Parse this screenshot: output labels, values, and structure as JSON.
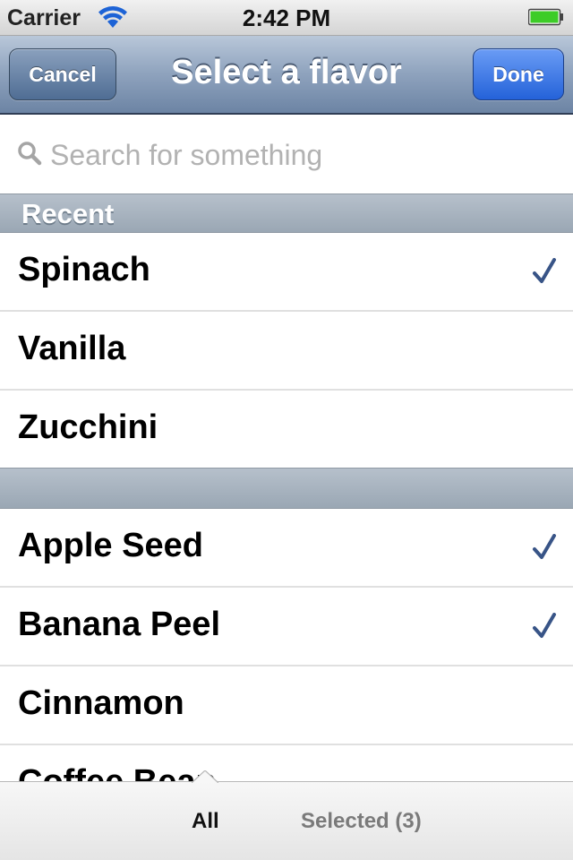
{
  "status_bar": {
    "carrier": "Carrier",
    "time": "2:42 PM",
    "wifi_icon": "wifi-icon",
    "battery_icon": "battery-icon",
    "battery_color": "#3dcc27"
  },
  "nav": {
    "title": "Select a flavor",
    "cancel_label": "Cancel",
    "done_label": "Done"
  },
  "search": {
    "placeholder": "Search for something",
    "value": "",
    "icon": "search-icon"
  },
  "sections": [
    {
      "header": "Recent",
      "rows": [
        {
          "label": "Spinach",
          "checked": true
        },
        {
          "label": "Vanilla",
          "checked": false
        },
        {
          "label": "Zucchini",
          "checked": false
        }
      ]
    },
    {
      "header": "",
      "rows": [
        {
          "label": "Apple Seed",
          "checked": true
        },
        {
          "label": "Banana Peel",
          "checked": true
        },
        {
          "label": "Cinnamon",
          "checked": false
        },
        {
          "label": "Coffee Bean",
          "checked": false
        }
      ]
    }
  ],
  "tab_bar": {
    "tabs": [
      {
        "label": "All",
        "active": true
      },
      {
        "label": "Selected (3)",
        "active": false
      }
    ]
  },
  "colors": {
    "checkmark": "#385487",
    "done_button": "#2a66dc"
  }
}
